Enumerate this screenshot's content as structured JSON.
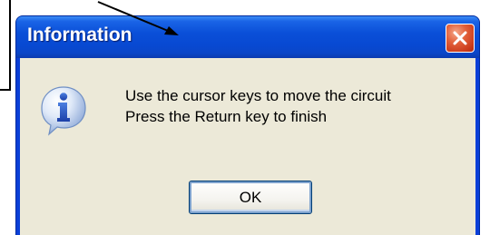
{
  "dialog": {
    "title": "Information",
    "close_icon": "close-icon",
    "icon": "information-icon",
    "message_lines": [
      "Use the cursor keys to move the circuit",
      "Press the Return key to finish"
    ],
    "ok_label": "OK"
  },
  "colors": {
    "titlebar": "#0a4fd8",
    "client_background": "#ece9d8",
    "close_button": "#e2603a",
    "text": "#000000"
  }
}
